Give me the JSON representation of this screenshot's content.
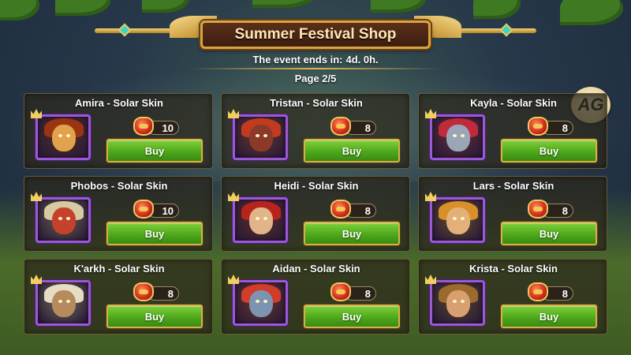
{
  "shop": {
    "title": "Summer Festival Shop",
    "event_label": "The event ends in:",
    "event_time": "4d. 0h.",
    "page_label": "Page 2/5",
    "badge": "AG"
  },
  "currency_icon": "festival-token-icon",
  "colors": {
    "buy_button": "#4ea81b",
    "portrait_border": "#9b59d6",
    "banner_border": "#d9a441"
  },
  "items": [
    {
      "title": "Amira - Solar Skin",
      "price": "10",
      "buy_label": "Buy",
      "face": "#e0a24a",
      "hair": "#9a3412"
    },
    {
      "title": "Tristan - Solar Skin",
      "price": "8",
      "buy_label": "Buy",
      "face": "#8b3a2a",
      "hair": "#c23b1e"
    },
    {
      "title": "Kayla - Solar Skin",
      "price": "8",
      "buy_label": "Buy",
      "face": "#9aa6b8",
      "hair": "#c02a3a"
    },
    {
      "title": "Phobos - Solar Skin",
      "price": "10",
      "buy_label": "Buy",
      "face": "#c4422c",
      "hair": "#d9c9a0"
    },
    {
      "title": "Heidi - Solar Skin",
      "price": "8",
      "buy_label": "Buy",
      "face": "#e2b48a",
      "hair": "#b8241c"
    },
    {
      "title": "Lars - Solar Skin",
      "price": "8",
      "buy_label": "Buy",
      "face": "#e4b07a",
      "hair": "#d98f2a"
    },
    {
      "title": "K'arkh - Solar Skin",
      "price": "8",
      "buy_label": "Buy",
      "face": "#b58a5c",
      "hair": "#e6dcc4"
    },
    {
      "title": "Aidan - Solar Skin",
      "price": "8",
      "buy_label": "Buy",
      "face": "#7e93b0",
      "hair": "#d23c2a"
    },
    {
      "title": "Krista - Solar Skin",
      "price": "8",
      "buy_label": "Buy",
      "face": "#d8a070",
      "hair": "#9b6a2c"
    }
  ]
}
